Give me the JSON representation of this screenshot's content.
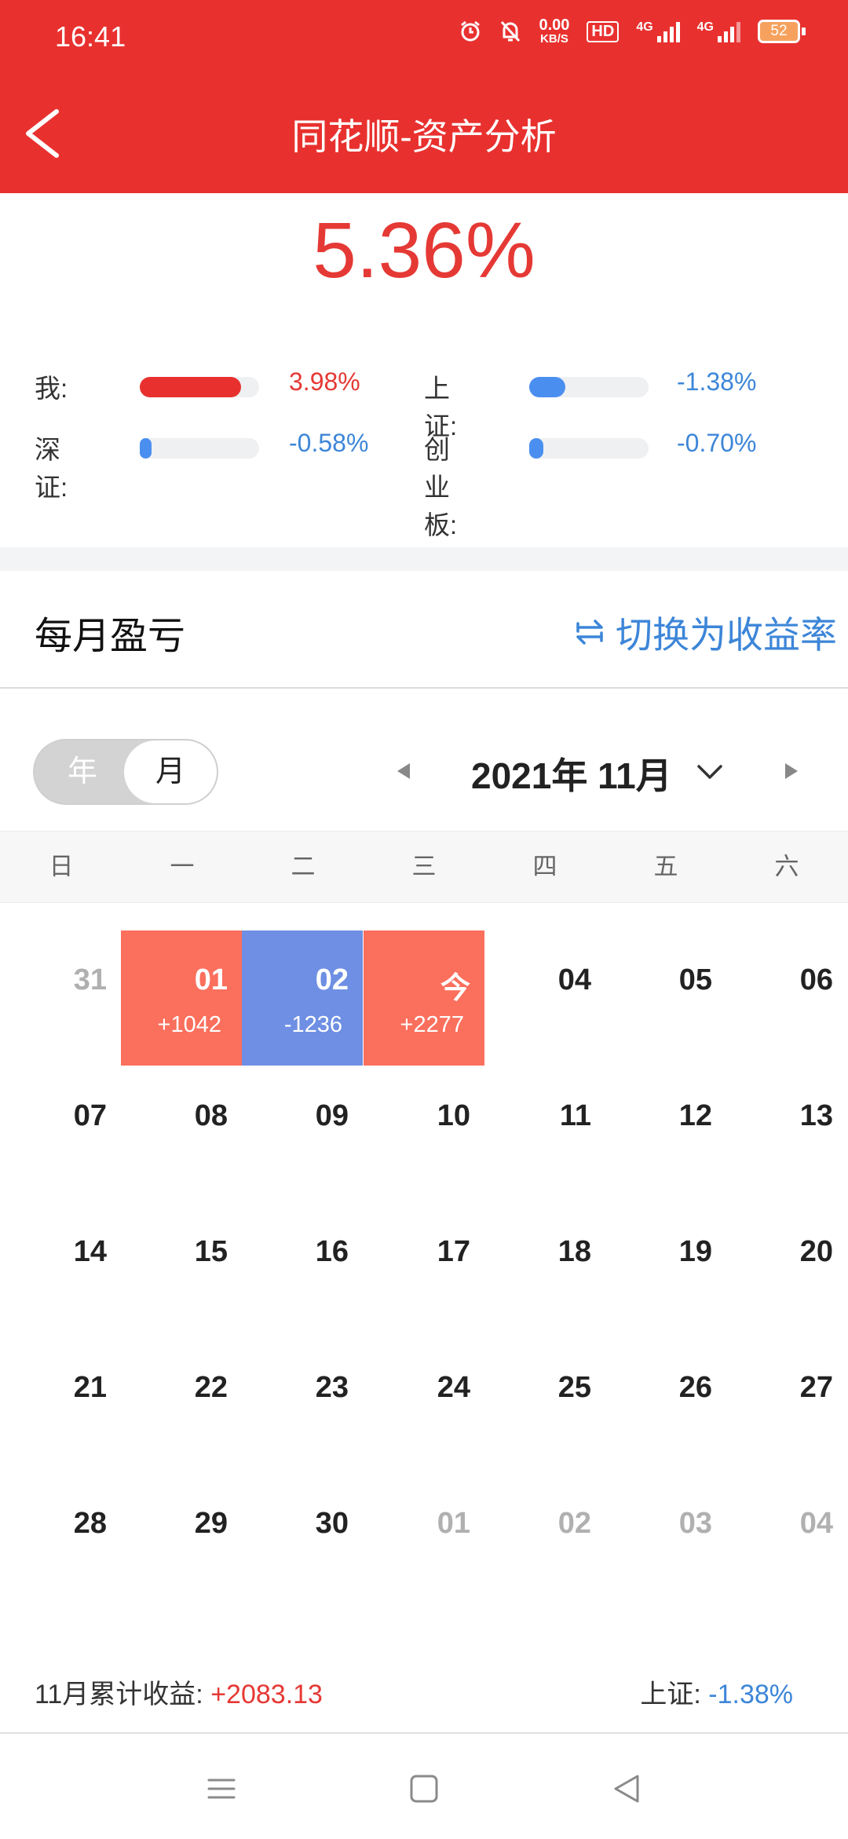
{
  "status": {
    "time": "16:41",
    "speed_value": "0.00",
    "speed_unit": "KB/S",
    "hd": "HD",
    "net1": "4G",
    "net2": "4G",
    "battery": "52"
  },
  "header": {
    "title": "同花顺-资产分析"
  },
  "summary": {
    "total_rate": "5.36%",
    "comparisons": [
      {
        "label": "我:",
        "value": "3.98%",
        "fill": 0.85,
        "color": "#e8312f",
        "text_color": "#e53935"
      },
      {
        "label": "上证:",
        "value": "-1.38%",
        "fill": 0.3,
        "color": "#4a8ff0",
        "text_color": "#3d86d8"
      },
      {
        "label": "深证:",
        "value": "-0.58%",
        "fill": 0.1,
        "color": "#4a8ff0",
        "text_color": "#3d86d8"
      },
      {
        "label": "创业板:",
        "value": "-0.70%",
        "fill": 0.12,
        "color": "#4a8ff0",
        "text_color": "#3d86d8"
      }
    ]
  },
  "section": {
    "title": "每月盈亏",
    "switch_label": "切换为收益率"
  },
  "period_toggle": {
    "year": "年",
    "month": "月",
    "selected": "月"
  },
  "month_nav": {
    "label": "2021年 11月"
  },
  "weekdays": [
    "日",
    "一",
    "二",
    "三",
    "四",
    "五",
    "六"
  ],
  "calendar": {
    "weeks": [
      [
        {
          "day": "31",
          "other": true
        },
        {
          "day": "01",
          "pnl": "+1042",
          "state": "gain"
        },
        {
          "day": "02",
          "pnl": "-1236",
          "state": "loss"
        },
        {
          "day": "今",
          "pnl": "+2277",
          "state": "gain"
        },
        {
          "day": "04"
        },
        {
          "day": "05"
        },
        {
          "day": "06"
        }
      ],
      [
        {
          "day": "07"
        },
        {
          "day": "08"
        },
        {
          "day": "09"
        },
        {
          "day": "10"
        },
        {
          "day": "11"
        },
        {
          "day": "12"
        },
        {
          "day": "13"
        }
      ],
      [
        {
          "day": "14"
        },
        {
          "day": "15"
        },
        {
          "day": "16"
        },
        {
          "day": "17"
        },
        {
          "day": "18"
        },
        {
          "day": "19"
        },
        {
          "day": "20"
        }
      ],
      [
        {
          "day": "21"
        },
        {
          "day": "22"
        },
        {
          "day": "23"
        },
        {
          "day": "24"
        },
        {
          "day": "25"
        },
        {
          "day": "26"
        },
        {
          "day": "27"
        }
      ],
      [
        {
          "day": "28"
        },
        {
          "day": "29"
        },
        {
          "day": "30"
        },
        {
          "day": "01",
          "other": true
        },
        {
          "day": "02",
          "other": true
        },
        {
          "day": "03",
          "other": true
        },
        {
          "day": "04",
          "other": true
        }
      ]
    ]
  },
  "footer": {
    "cumulative_label": "11月累计收益:",
    "cumulative_value": "+2083.13",
    "index_label": "上证:",
    "index_value": "-1.38%"
  },
  "icons": {
    "back": "chevron-left-icon",
    "switch": "swap-icon",
    "alarm": "alarm-icon",
    "mute": "bell-off-icon"
  }
}
